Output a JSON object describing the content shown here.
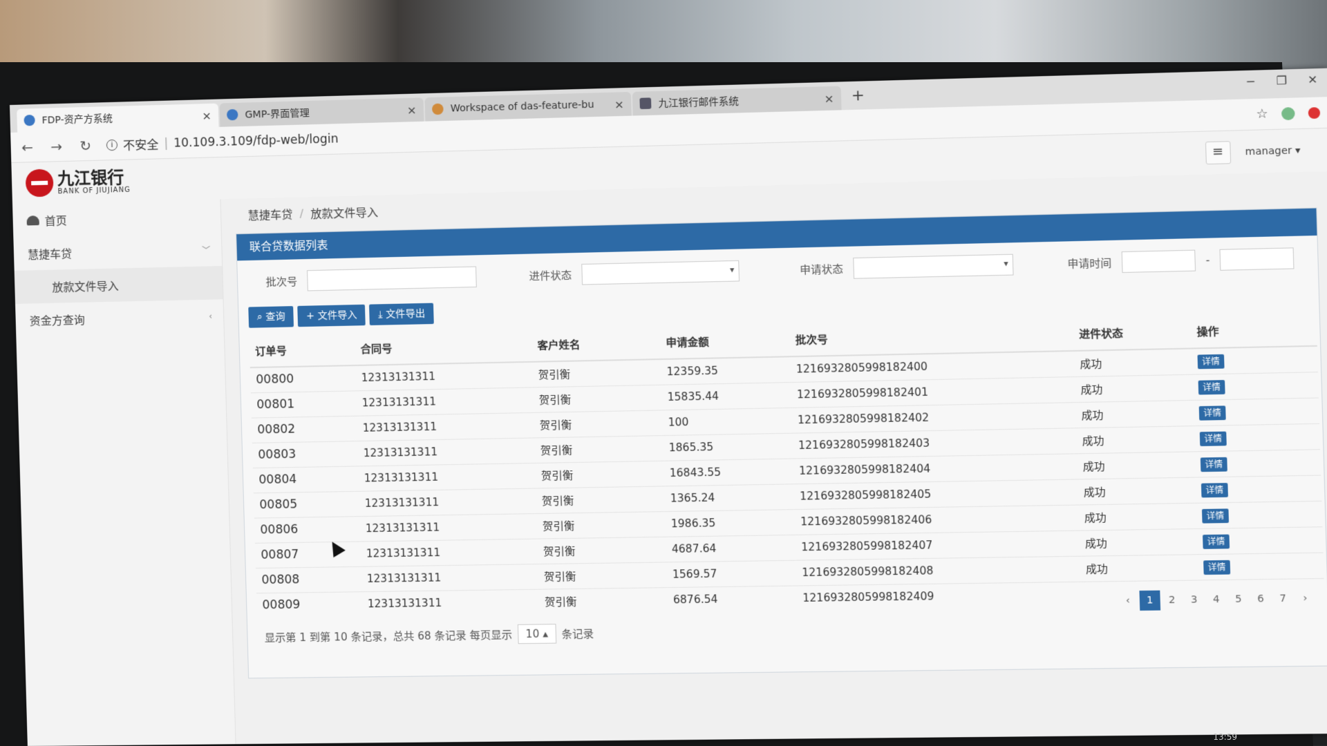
{
  "browser": {
    "tabs": [
      {
        "title": "FDP-资产方系统",
        "close": "×"
      },
      {
        "title": "GMP-界面管理",
        "close": "×"
      },
      {
        "title": "Workspace of das-feature-bu",
        "close": "×"
      },
      {
        "title": "九江银行邮件系统",
        "close": "×"
      }
    ],
    "new_tab": "+",
    "security_label": "不安全",
    "url": "10.109.3.109/fdp-web/login"
  },
  "header": {
    "bank_name_cn": "九江银行",
    "bank_name_en": "BANK OF JIUJIANG",
    "user": "manager"
  },
  "sidebar": {
    "items": [
      {
        "label": "首页"
      },
      {
        "label": "慧捷车贷"
      },
      {
        "label": "放款文件导入"
      },
      {
        "label": "资金方查询"
      }
    ]
  },
  "breadcrumb": {
    "root": "慧捷车贷",
    "current": "放款文件导入"
  },
  "panel": {
    "title": "联合贷数据列表",
    "filters": {
      "batch_label": "批次号",
      "progress_label": "进件状态",
      "apply_status_label": "申请状态",
      "apply_time_label": "申请时间",
      "date_sep": "-"
    },
    "buttons": {
      "query": "查询",
      "import": "文件导入",
      "export": "文件导出"
    },
    "columns": [
      "订单号",
      "合同号",
      "客户姓名",
      "申请金额",
      "批次号",
      "进件状态",
      "操作"
    ],
    "rows": [
      [
        "00800",
        "12313131311",
        "贺引衡",
        "12359.35",
        "1216932805998182400",
        "成功",
        "详情"
      ],
      [
        "00801",
        "12313131311",
        "贺引衡",
        "15835.44",
        "1216932805998182401",
        "成功",
        "详情"
      ],
      [
        "00802",
        "12313131311",
        "贺引衡",
        "100",
        "1216932805998182402",
        "成功",
        "详情"
      ],
      [
        "00803",
        "12313131311",
        "贺引衡",
        "1865.35",
        "1216932805998182403",
        "成功",
        "详情"
      ],
      [
        "00804",
        "12313131311",
        "贺引衡",
        "16843.55",
        "1216932805998182404",
        "成功",
        "详情"
      ],
      [
        "00805",
        "12313131311",
        "贺引衡",
        "1365.24",
        "1216932805998182405",
        "成功",
        "详情"
      ],
      [
        "00806",
        "12313131311",
        "贺引衡",
        "1986.35",
        "1216932805998182406",
        "成功",
        "详情"
      ],
      [
        "00807",
        "12313131311",
        "贺引衡",
        "4687.64",
        "1216932805998182407",
        "成功",
        "详情"
      ],
      [
        "00808",
        "12313131311",
        "贺引衡",
        "1569.57",
        "1216932805998182408",
        "成功",
        "详情"
      ],
      [
        "00809",
        "12313131311",
        "贺引衡",
        "6876.54",
        "1216932805998182409",
        "",
        ""
      ]
    ],
    "footer": {
      "summary": "显示第 1 到第 10 条记录，总共 68 条记录 每页显示",
      "page_size": "10",
      "suffix": "条记录"
    },
    "pages": [
      "‹",
      "1",
      "2",
      "3",
      "4",
      "5",
      "6",
      "7",
      "›"
    ],
    "active_page": "1"
  },
  "taskbar": {
    "time": "13:59"
  },
  "colors": {
    "primary": "#2d6aa6",
    "brand_red": "#c8161d"
  }
}
